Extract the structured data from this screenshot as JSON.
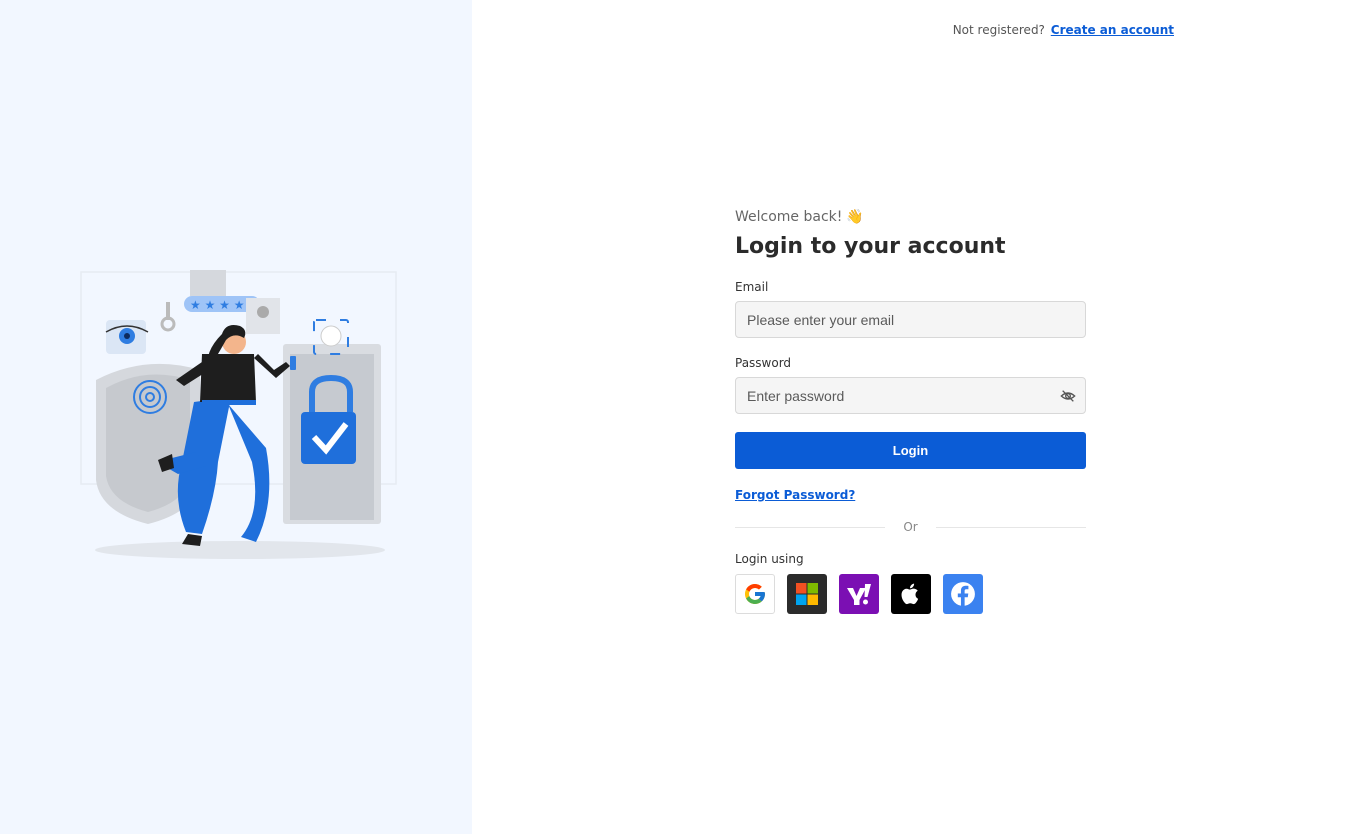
{
  "header": {
    "prompt_text": "Not registered?",
    "create_account_link": "Create an account"
  },
  "form": {
    "welcome_text": "Welcome back!",
    "welcome_emoji": "👋",
    "title": "Login to your account",
    "email": {
      "label": "Email",
      "placeholder": "Please enter your email",
      "value": ""
    },
    "password": {
      "label": "Password",
      "placeholder": "Enter password",
      "value": "",
      "toggle_icon": "eye-off-icon"
    },
    "login_button": "Login",
    "forgot_password": "Forgot Password?",
    "divider_text": "Or",
    "login_using": "Login using",
    "social_providers": [
      {
        "name": "Google",
        "icon": "google-icon",
        "color": "#ffffff"
      },
      {
        "name": "Microsoft",
        "icon": "microsoft-icon",
        "color": "#2b2b2b"
      },
      {
        "name": "Yahoo",
        "icon": "yahoo-icon",
        "color": "#7b0fb3"
      },
      {
        "name": "Apple",
        "icon": "apple-icon",
        "color": "#000000"
      },
      {
        "name": "Facebook",
        "icon": "facebook-icon",
        "color": "#3b82f0"
      }
    ]
  },
  "colors": {
    "accent": "#0b5cd6",
    "left_panel_bg": "#f2f7ff"
  }
}
